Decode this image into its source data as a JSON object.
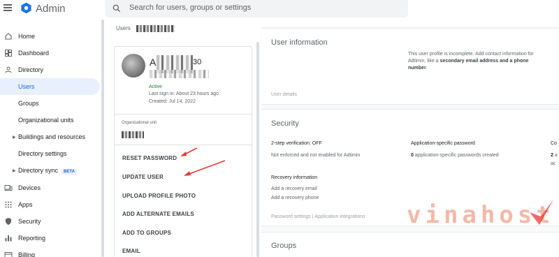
{
  "header": {
    "app_title": "Admin",
    "search_placeholder": "Search for users, groups or settings"
  },
  "sidebar": {
    "items": [
      {
        "label": "Home",
        "icon": "home-icon"
      },
      {
        "label": "Dashboard",
        "icon": "dashboard-icon"
      },
      {
        "label": "Directory",
        "icon": "person-icon"
      },
      {
        "label": "Users",
        "active": true
      },
      {
        "label": "Groups"
      },
      {
        "label": "Organizational units"
      },
      {
        "label": "Buildings and resources",
        "expandable": true
      },
      {
        "label": "Directory settings"
      },
      {
        "label": "Directory sync",
        "expandable": true,
        "badge": "BETA"
      },
      {
        "label": "Devices",
        "icon": "devices-icon"
      },
      {
        "label": "Apps",
        "icon": "apps-grid-icon"
      },
      {
        "label": "Security",
        "icon": "shield-icon"
      },
      {
        "label": "Reporting",
        "icon": "bar-chart-icon"
      },
      {
        "label": "Billing",
        "icon": "billing-icon"
      }
    ]
  },
  "breadcrumb": {
    "root": "Users"
  },
  "user_card": {
    "name_visible": "A",
    "name_tail": "30",
    "status": "Active",
    "last_sign_in": "Last sign in: About 23 hours ago",
    "created": "Created: Jul 14, 2022",
    "org_unit_label": "Organizational unit",
    "actions": [
      "RESET PASSWORD",
      "UPDATE USER",
      "UPLOAD PROFILE PHOTO",
      "ADD ALTERNATE EMAILS",
      "ADD TO GROUPS",
      "EMAIL"
    ]
  },
  "user_information": {
    "title": "User information",
    "incomplete_text": "This user profile is incomplete. Add contact information for Adtimin, like a",
    "incomplete_bold": "secondary email address and a phone number",
    "incomplete_end": ".",
    "details_link": "User details"
  },
  "security": {
    "title": "Security",
    "two_step_label": "2-step verification: OFF",
    "two_step_value": "Not enforced and not enabled for Adtimin",
    "app_password_label": "Application-specific password",
    "app_password_count": "0",
    "app_password_value": "application-specific passwords created",
    "third_col_label": "Co",
    "third_col_count": "2",
    "third_col_value": "a",
    "third_col_value2": "ac",
    "recovery_label": "Recovery information",
    "recovery_email": "Add a recovery email",
    "recovery_phone": "Add a recovery phone",
    "footer_links": "Password settings | Application integrations"
  },
  "groups": {
    "title": "Groups"
  },
  "watermark": {
    "text": "vinahost."
  },
  "colors": {
    "accent": "#1a73e8",
    "active_bg": "#e8f0fe",
    "active_status": "#188038",
    "annotation": "#e53935"
  }
}
